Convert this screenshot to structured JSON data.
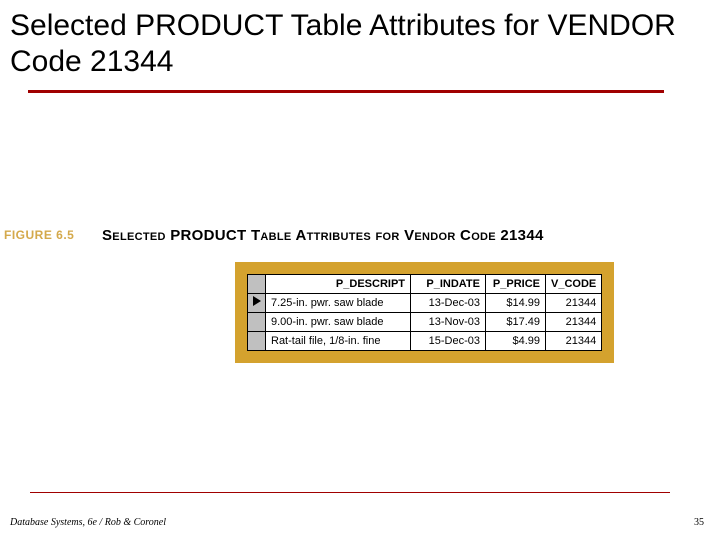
{
  "title": "Selected PRODUCT Table Attributes for VENDOR Code 21344",
  "figure": {
    "number": "FIGURE 6.5",
    "caption": "Selected PRODUCT Table Attributes for Vendor Code 21344"
  },
  "table": {
    "headers": {
      "descript": "P_DESCRIPT",
      "indate": "P_INDATE",
      "price": "P_PRICE",
      "vcode": "V_CODE"
    },
    "rows": [
      {
        "current": true,
        "descript": "7.25-in. pwr. saw blade",
        "indate": "13-Dec-03",
        "price": "$14.99",
        "vcode": "21344"
      },
      {
        "current": false,
        "descript": "9.00-in. pwr. saw blade",
        "indate": "13-Nov-03",
        "price": "$17.49",
        "vcode": "21344"
      },
      {
        "current": false,
        "descript": "Rat-tail file, 1/8-in. fine",
        "indate": "15-Dec-03",
        "price": "$4.99",
        "vcode": "21344"
      }
    ]
  },
  "footer": {
    "citation": "Database Systems, 6e / Rob & Coronel",
    "page": "35"
  }
}
